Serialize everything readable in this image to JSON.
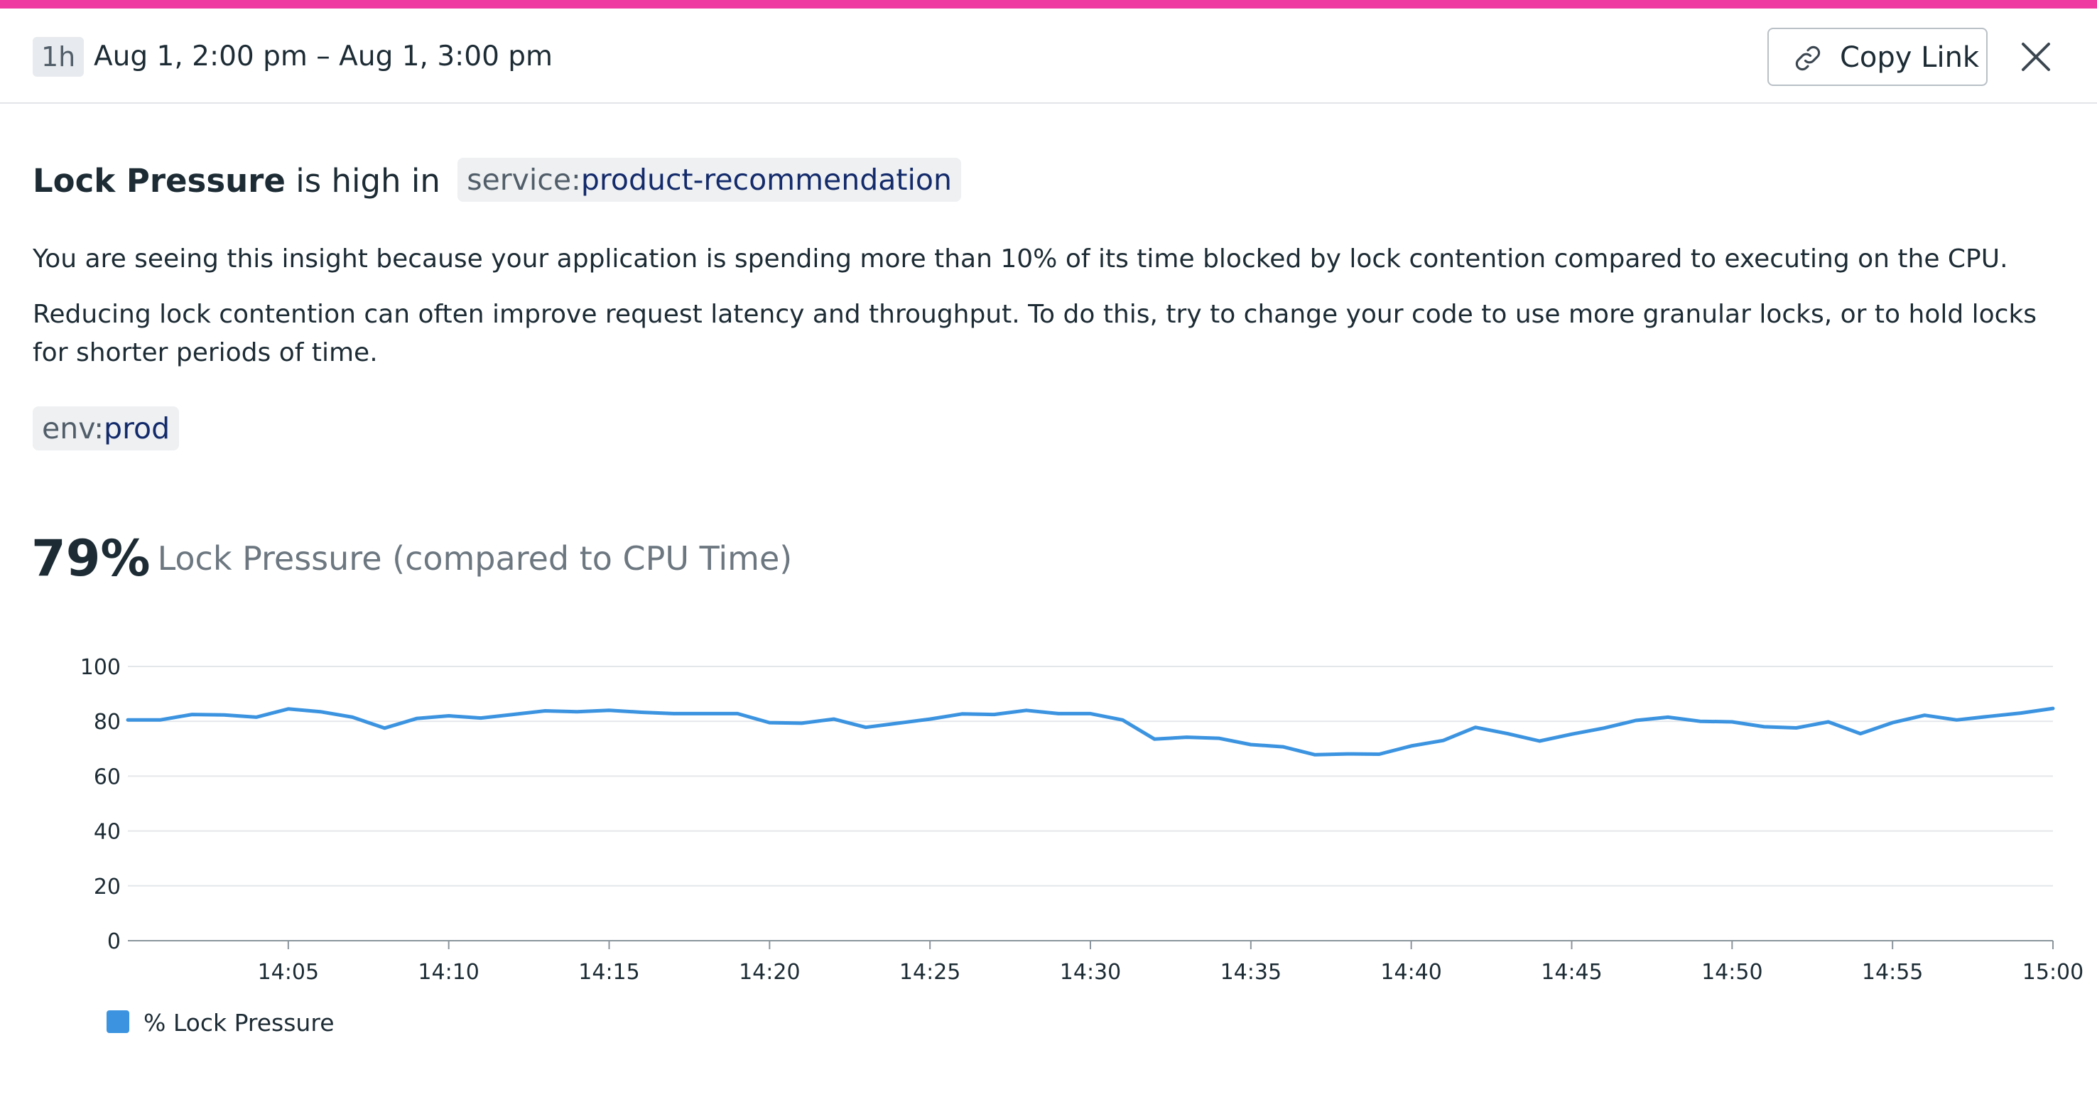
{
  "header": {
    "range_badge": "1h",
    "range_text": "Aug 1, 2:00 pm – Aug 1, 3:00 pm",
    "copy_link_label": "Copy Link"
  },
  "insight": {
    "metric_name": "Lock Pressure",
    "title_suffix": "is high in",
    "service_tag": {
      "key": "service:",
      "value": "product-recommendation"
    },
    "paragraph_1": "You are seeing this insight because your application is spending more than 10% of its time blocked by lock contention compared to executing on the CPU.",
    "paragraph_2": "Reducing lock contention can often improve request latency and throughput. To do this, try to change your code to use more granular locks, or to hold locks for shorter periods of time.",
    "env_tag": {
      "key": "env:",
      "value": "prod"
    }
  },
  "summary": {
    "value": "79%",
    "description": "Lock Pressure (compared to CPU Time)"
  },
  "colors": {
    "accent": "#ee3aa1",
    "series": "#3c94e0"
  },
  "chart_data": {
    "type": "line",
    "title": "",
    "xlabel": "",
    "ylabel": "",
    "ylim": [
      0,
      100
    ],
    "yticks": [
      "0",
      "20",
      "40",
      "60",
      "80",
      "100"
    ],
    "xticks": [
      "14:05",
      "14:10",
      "14:15",
      "14:20",
      "14:25",
      "14:30",
      "14:35",
      "14:40",
      "14:45",
      "14:50",
      "14:55",
      "15:00"
    ],
    "grid": true,
    "legend_position": "bottom-left",
    "series": [
      {
        "name": "% Lock Pressure",
        "x": [
          "14:00",
          "14:01",
          "14:02",
          "14:03",
          "14:04",
          "14:05",
          "14:06",
          "14:07",
          "14:08",
          "14:09",
          "14:10",
          "14:11",
          "14:12",
          "14:13",
          "14:14",
          "14:15",
          "14:16",
          "14:17",
          "14:18",
          "14:19",
          "14:20",
          "14:21",
          "14:22",
          "14:23",
          "14:24",
          "14:25",
          "14:26",
          "14:27",
          "14:28",
          "14:29",
          "14:30",
          "14:31",
          "14:32",
          "14:33",
          "14:34",
          "14:35",
          "14:36",
          "14:37",
          "14:38",
          "14:39",
          "14:40",
          "14:41",
          "14:42",
          "14:43",
          "14:44",
          "14:45",
          "14:46",
          "14:47",
          "14:48",
          "14:49",
          "14:50",
          "14:51",
          "14:52",
          "14:53",
          "14:54",
          "14:55",
          "14:56",
          "14:57",
          "14:58",
          "14:59",
          "15:00"
        ],
        "values": [
          80.5,
          80.5,
          82.5,
          82.3,
          81.5,
          84.5,
          83.5,
          81.5,
          77.5,
          81,
          82,
          81.2,
          82.5,
          83.8,
          83.5,
          84,
          83.3,
          82.8,
          82.8,
          82.8,
          79.5,
          79.3,
          80.8,
          77.8,
          79.3,
          80.8,
          82.7,
          82.5,
          84,
          82.8,
          82.8,
          80.5,
          73.5,
          74.2,
          73.8,
          71.5,
          70.7,
          67.8,
          68.1,
          68,
          71,
          73,
          77.8,
          75.5,
          72.8,
          75.3,
          77.5,
          80.3,
          81.5,
          80,
          79.8,
          78,
          77.6,
          79.8,
          75.5,
          79.5,
          82.2,
          80.5,
          81.8,
          83,
          84.7
        ]
      }
    ]
  }
}
